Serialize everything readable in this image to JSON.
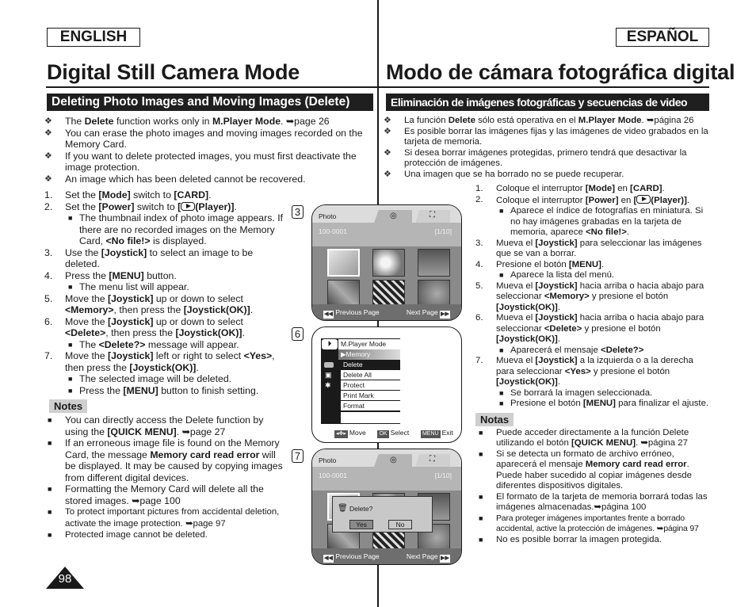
{
  "page_number": "98",
  "english": {
    "lang_label": "ENGLISH",
    "title": "Digital Still Camera Mode",
    "section": "Deleting Photo Images and Moving Images (Delete)",
    "intro": [
      {
        "pre": "The ",
        "b1": "Delete",
        "mid": " function works only in ",
        "b2": "M.Player Mode",
        "post": ". ➥page 26"
      },
      {
        "text": "You can erase the photo images and moving images recorded on the Memory Card."
      },
      {
        "text": "If you want to delete protected images, you must first deactivate the image protection."
      },
      {
        "text": "An image which has been deleted cannot be recovered."
      }
    ],
    "steps": {
      "s1": {
        "num": "1.",
        "a": "Set the ",
        "b": "[Mode]",
        "c": " switch to ",
        "d": "[CARD]",
        "e": "."
      },
      "s2": {
        "num": "2.",
        "a": "Set the ",
        "b": "[Power]",
        "c": " switch to ",
        "d1": "[",
        "d2": "(Player)]",
        "e": "."
      },
      "s2_sub": {
        "a": "The thumbnail index of photo image appears. If there are no recorded images on the Memory Card, ",
        "b": "<No file!>",
        "c": " is displayed."
      },
      "s3": {
        "num": "3.",
        "a": "Use the ",
        "b": "[Joystick]",
        "c": " to select an image to be deleted."
      },
      "s4": {
        "num": "4.",
        "a": "Press the ",
        "b": "[MENU]",
        "c": " button."
      },
      "s4_sub": "The menu list will appear.",
      "s5": {
        "num": "5.",
        "a": "Move the ",
        "b": "[Joystick]",
        "c": " up or down to select ",
        "d": "<Memory>",
        "e": ", then press the ",
        "f": "[Joystick(OK)]",
        "g": "."
      },
      "s6": {
        "num": "6.",
        "a": "Move the ",
        "b": "[Joystick]",
        "c": " up or down to select ",
        "d": "<Delete>",
        "e": ", then press the ",
        "f": "[Joystick(OK)]",
        "g": "."
      },
      "s6_sub": {
        "a": "The ",
        "b": "<Delete?>",
        "c": " message will appear."
      },
      "s7": {
        "num": "7.",
        "a": "Move the ",
        "b": "[Joystick]",
        "c": " left or right to select ",
        "d": "<Yes>",
        "e": ", then press the ",
        "f": "[Joystick(OK)]",
        "g": "."
      },
      "s7_sub1": "The selected image will be deleted.",
      "s7_sub2": {
        "a": "Press the ",
        "b": "[MENU]",
        "c": " button to finish setting."
      }
    },
    "notes_label": "Notes",
    "notes": {
      "n1": {
        "a": "You can directly access the Delete function by using the ",
        "b": "[QUICK MENU]",
        "c": ". ➥page 27"
      },
      "n2": {
        "a": "If an erroneous image file is found on the Memory Card, the message ",
        "b": "Memory card read error",
        "c": " will be displayed. It may be caused by copying images from different digital devices."
      },
      "n3": "Formatting the Memory Card will delete all the stored images. ➥page 100",
      "n4": "To protect important pictures from accidental deletion, activate the image protection. ➥page 97",
      "n5": "Protected image cannot be deleted."
    }
  },
  "espanol": {
    "lang_label": "ESPAÑOL",
    "title": "Modo de cámara fotográfica digital",
    "section": "Eliminación de imágenes fotográficas y secuencias de video (Delete)",
    "intro": [
      {
        "pre": "La función ",
        "b1": "Delete",
        "mid": " sólo está operativa en el ",
        "b2": "M.Player Mode",
        "post": ". ➥página 26"
      },
      {
        "text": "Es posible borrar las imágenes fijas y las imágenes de video grabados en la tarjeta de memoria."
      },
      {
        "text": "Si desea borrar imágenes protegidas, primero tendrá que desactivar la protección de imágenes."
      },
      {
        "text": "Una imagen que se ha borrado no se puede recuperar."
      }
    ],
    "steps": {
      "s1": {
        "num": "1.",
        "a": "Coloque el interruptor ",
        "b": "[Mode]",
        "c": " en ",
        "d": "[CARD]",
        "e": "."
      },
      "s2": {
        "num": "2.",
        "a": "Coloque el interruptor ",
        "b": "[Power]",
        "c": " en ",
        "d1": "[",
        "d2": "(Player)]",
        "e": "."
      },
      "s2_sub": {
        "a": "Aparece el índice de fotografías en miniatura. Si no hay imágenes grabadas en la tarjeta de memoria, aparece ",
        "b": "<No file!>",
        "c": "."
      },
      "s3": {
        "num": "3.",
        "a": "Mueva el ",
        "b": "[Joystick]",
        "c": " para seleccionar las imágenes que se van a borrar."
      },
      "s4": {
        "num": "4.",
        "a": "Presione el botón ",
        "b": "[MENU]",
        "c": "."
      },
      "s4_sub": "Aparece la lista del menú.",
      "s5": {
        "num": "5.",
        "a": "Mueva el ",
        "b": "[Joystick]",
        "c": " hacia arriba o hacia abajo para seleccionar ",
        "d": "<Memory>",
        "e": " y presione el botón ",
        "f": "[Joystick(OK)]",
        "g": "."
      },
      "s6": {
        "num": "6.",
        "a": "Mueva el ",
        "b": "[Joystick]",
        "c": " hacia arriba o hacia abajo para seleccionar ",
        "d": "<Delete>",
        "e": " y presione el botón ",
        "f": "[Joystick(OK)]",
        "g": "."
      },
      "s6_sub": {
        "a": "Aparecerá el mensaje ",
        "b": "<Delete?>",
        "c": ""
      },
      "s7": {
        "num": "7.",
        "a": "Mueva el ",
        "b": "[Joystick]",
        "c": " a la izquierda o a la derecha para seleccionar ",
        "d": "<Yes>",
        "e": " y presione el botón ",
        "f": "[Joystick(OK)]",
        "g": "."
      },
      "s7_sub1": "Se borrará la imagen seleccionada.",
      "s7_sub2": {
        "a": "Presione el botón ",
        "b": "[MENU]",
        "c": " para finalizar el ajuste."
      }
    },
    "notes_label": "Notas",
    "notes": {
      "n1": {
        "a": "Puede acceder directamente a la función Delete utilizando el botón ",
        "b": "[QUICK MENU]",
        "c": ". ➥página 27"
      },
      "n2": {
        "a": "Si se detecta un formato de archivo erróneo, aparecerá el mensaje ",
        "b": "Memory card read error",
        "c": ". Puede haber sucedido al copiar imágenes desde diferentes dispositivos digitales."
      },
      "n3": "El formato de la tarjeta de memoria borrará todas las imágenes almacenadas.➥página 100",
      "n4": "Para proteger imágenes importantes frente a borrado accidental, active la protección de imágenes. ➥página 97",
      "n5": "No es posible borrar la imagen protegida."
    }
  },
  "screens": {
    "step3": {
      "num": "3",
      "label": "Photo",
      "folder": "100-0001",
      "counter": "[1/10]",
      "prev": "Previous Page",
      "next": "Next Page",
      "tab_photo_icon": "camera-icon",
      "tab_movie_icon": "camcorder-icon"
    },
    "step6": {
      "num": "6",
      "header": "M.Player Mode",
      "selected": "▶Memory",
      "items": [
        "Delete",
        "Delete All",
        "Protect",
        "Print Mark",
        "Format"
      ],
      "move": "Move",
      "ok_key": "OK",
      "select": "Select",
      "menu_key": "MENU",
      "exit": "Exit"
    },
    "step7": {
      "num": "7",
      "label": "Photo",
      "folder": "100-0001",
      "counter": "[1/10]",
      "dialog": "Delete?",
      "yes": "Yes",
      "no": "No",
      "prev": "Previous Page",
      "next": "Next Page"
    }
  },
  "colors": {
    "section_bg": "#1f1f1f",
    "notes_bg": "#cfcfcf",
    "screen_header": "#b5b5b5",
    "screen_grid": "#8a8a8a"
  }
}
